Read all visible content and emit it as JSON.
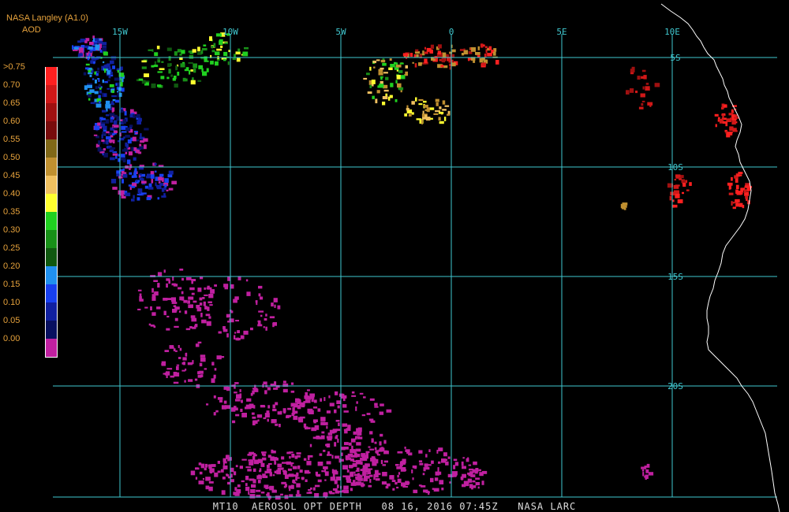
{
  "header": {
    "producer": "NASA Langley (A1.0)",
    "unit": "AOD"
  },
  "legend": {
    "entries": [
      {
        "label": ">0.75",
        "color": "#ff2020"
      },
      {
        "label": "0.70",
        "color": "#d01818"
      },
      {
        "label": "0.65",
        "color": "#a01010"
      },
      {
        "label": "0.60",
        "color": "#780c0c"
      },
      {
        "label": "0.55",
        "color": "#806818"
      },
      {
        "label": "0.50",
        "color": "#c09030"
      },
      {
        "label": "0.45",
        "color": "#f0c060"
      },
      {
        "label": "0.40",
        "color": "#ffff30"
      },
      {
        "label": "0.35",
        "color": "#20d020"
      },
      {
        "label": "0.30",
        "color": "#189018"
      },
      {
        "label": "0.25",
        "color": "#105810"
      },
      {
        "label": "0.20",
        "color": "#2090f0"
      },
      {
        "label": "0.15",
        "color": "#1840f0"
      },
      {
        "label": "0.10",
        "color": "#1020a0"
      },
      {
        "label": "0.05",
        "color": "#081060"
      },
      {
        "label": "0.00",
        "color": "#c020a0"
      }
    ]
  },
  "map": {
    "lon_range": [
      -20,
      11
    ],
    "lat_range": [
      -25,
      -3
    ],
    "grid": {
      "meridians": [
        {
          "lon": -15,
          "label": "15W"
        },
        {
          "lon": -10,
          "label": "10W"
        },
        {
          "lon": -5,
          "label": "5W"
        },
        {
          "lon": 0,
          "label": "0"
        },
        {
          "lon": 5,
          "label": "5E"
        },
        {
          "lon": 10,
          "label": "10E"
        }
      ],
      "parallels": [
        {
          "lat": -5,
          "label": "5S"
        },
        {
          "lat": -10,
          "label": "10S"
        },
        {
          "lat": -15,
          "label": "15S"
        },
        {
          "lat": -20,
          "label": "20S"
        }
      ],
      "color": "#40c8d0"
    },
    "coastline_color": "#ffffff"
  },
  "footer": {
    "caption": "MT10  AEROSOL OPT DEPTH   08 16, 2016 07:45Z   NASA LARC"
  }
}
